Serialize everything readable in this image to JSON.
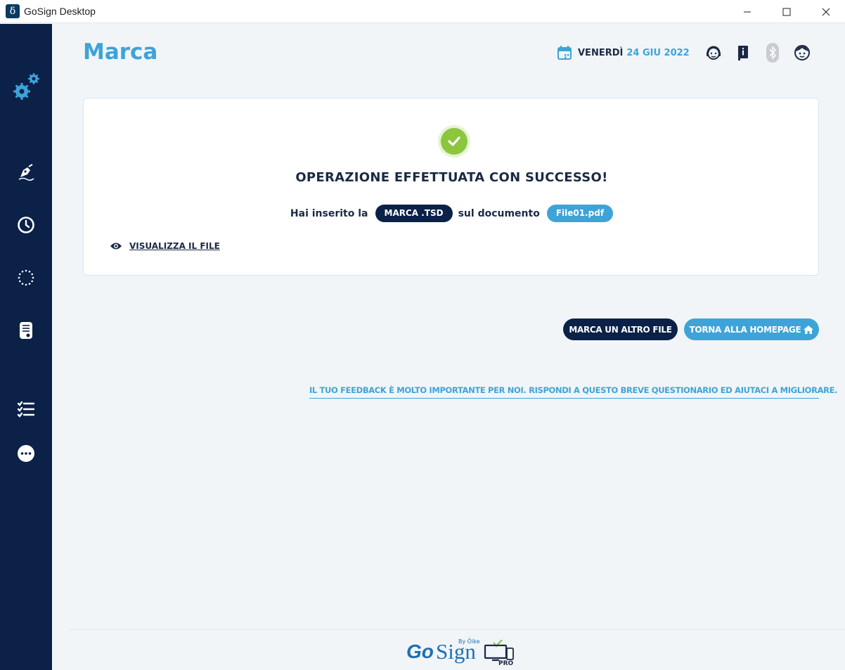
{
  "window": {
    "title": "GoSign Desktop",
    "app_icon_glyph": "δ",
    "controls": [
      "minimize-icon",
      "maximize-icon",
      "close-icon"
    ]
  },
  "sidebar": {
    "items": [
      {
        "icon": "settings-gears-icon"
      },
      {
        "icon": "sign-pen-icon"
      },
      {
        "icon": "clock-icon"
      },
      {
        "icon": "loading-circle-icon"
      },
      {
        "icon": "document-stamp-icon"
      },
      {
        "icon": "checklist-icon"
      },
      {
        "icon": "more-icon"
      }
    ]
  },
  "header": {
    "title": "Marca",
    "date_day": "VENERDÌ",
    "date_rest": "24 GIU 2022",
    "icons": [
      "calendar-icon",
      "support-icon",
      "info-book-icon",
      "bluetooth-icon",
      "user-avatar-icon"
    ]
  },
  "card": {
    "success_text": "OPERAZIONE EFFETTUATA CON SUCCESSO!",
    "info_prefix": "Hai inserito la",
    "mark_label": "MARCA .TSD",
    "info_middle": "sul documento",
    "file_name": "File01.pdf",
    "view_link": "VISUALIZZA IL FILE"
  },
  "actions": {
    "mark_another": "MARCA UN ALTRO FILE",
    "back_home": "TORNA ALLA HOMEPAGE"
  },
  "feedback_text": "IL TUO FEEDBACK È MOLTO IMPORTANTE PER NOI. RISPONDI A QUESTO BREVE QUESTIONARIO ED AIUTACI A MIGLIORARE.",
  "footer": {
    "logo_go": "Go",
    "logo_sign": "Sign",
    "logo_by": "By Öike",
    "logo_pro": "PRO"
  },
  "colors": {
    "sidebar": "#0b2147",
    "accent": "#3ea3d8",
    "success": "#8cc63f",
    "text_dark": "#1b2a44",
    "background": "#f1f5f8"
  }
}
